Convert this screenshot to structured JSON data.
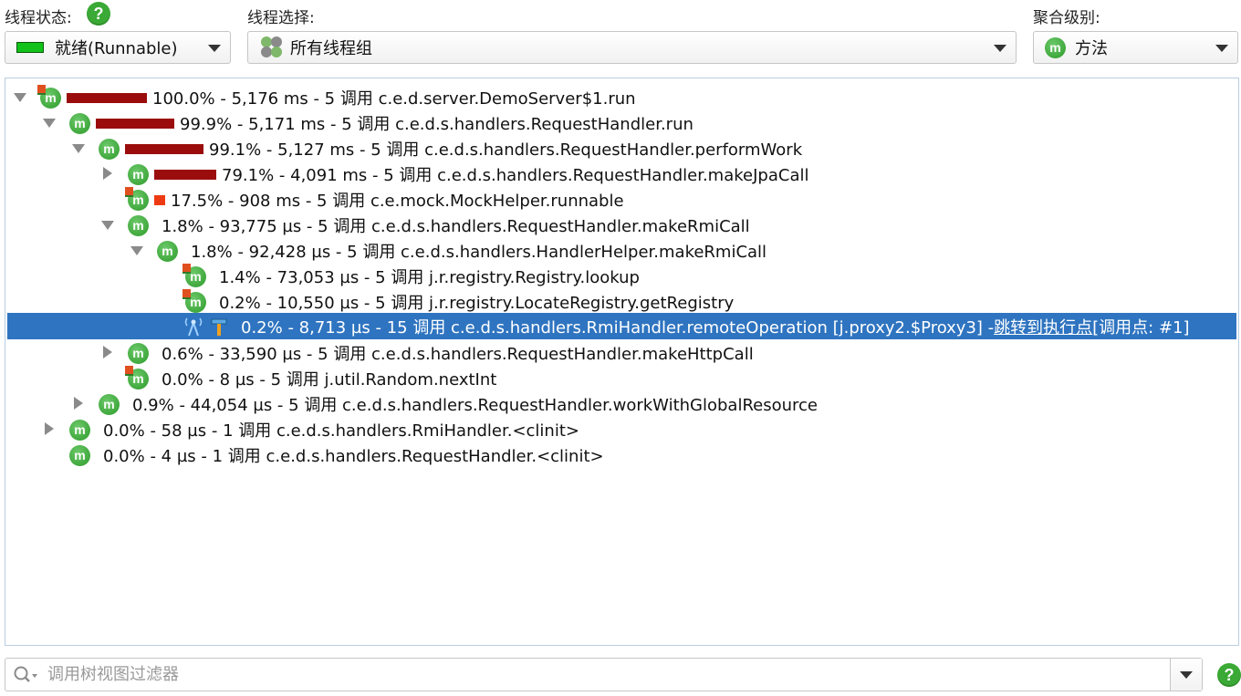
{
  "toolbar": {
    "state_label": "线程状态:",
    "state_value": "就绪(Runnable)",
    "thread_label": "线程选择:",
    "thread_value": "所有线程组",
    "aggregation_label": "聚合级别:",
    "aggregation_value": "方法",
    "help_glyph": "?"
  },
  "tree": {
    "icon_letter": "m",
    "rows": [
      {
        "text": "100.0% - 5,176 ms - 5 调用 c.e.d.server.DemoServer$1.run"
      },
      {
        "text": "99.9% - 5,171 ms - 5 调用 c.e.d.s.handlers.RequestHandler.run"
      },
      {
        "text": "99.1% - 5,127 ms - 5 调用 c.e.d.s.handlers.RequestHandler.performWork"
      },
      {
        "text": "79.1% - 4,091 ms - 5 调用 c.e.d.s.handlers.RequestHandler.makeJpaCall"
      },
      {
        "text": "17.5% - 908 ms - 5 调用 c.e.mock.MockHelper.runnable"
      },
      {
        "text": "1.8% - 93,775 µs - 5 调用 c.e.d.s.handlers.RequestHandler.makeRmiCall"
      },
      {
        "text": "1.8% - 92,428 µs - 5 调用 c.e.d.s.handlers.HandlerHelper.makeRmiCall"
      },
      {
        "text": "1.4% - 73,053 µs - 5 调用 j.r.registry.Registry.lookup"
      },
      {
        "text": "0.2% - 10,550 µs - 5 调用 j.r.registry.LocateRegistry.getRegistry"
      },
      {
        "text": "0.2% - 8,713 µs - 15 调用 c.e.d.s.handlers.RmiHandler.remoteOperation [j.proxy2.$Proxy3] - ",
        "link": "跳转到执行点",
        "suffix": " [调用点: #1]"
      },
      {
        "text": "0.6% - 33,590 µs - 5 调用 c.e.d.s.handlers.RequestHandler.makeHttpCall"
      },
      {
        "text": "0.0% - 8 µs - 5 调用 j.util.Random.nextInt"
      },
      {
        "text": "0.9% - 44,054 µs - 5 调用 c.e.d.s.handlers.RequestHandler.workWithGlobalResource"
      },
      {
        "text": "0.0% - 58 µs - 1 调用 c.e.d.s.handlers.RmiHandler.<clinit>"
      },
      {
        "text": "0.0% - 4 µs - 1 调用 c.e.d.s.handlers.RequestHandler.<clinit>"
      }
    ]
  },
  "filter": {
    "placeholder": "调用树视图过滤器"
  },
  "colors": {
    "selection": "#2f74c0",
    "bar_dark": "#9b0d0d",
    "bar_red": "#ee3a12",
    "method_icon": "#3aa935"
  }
}
